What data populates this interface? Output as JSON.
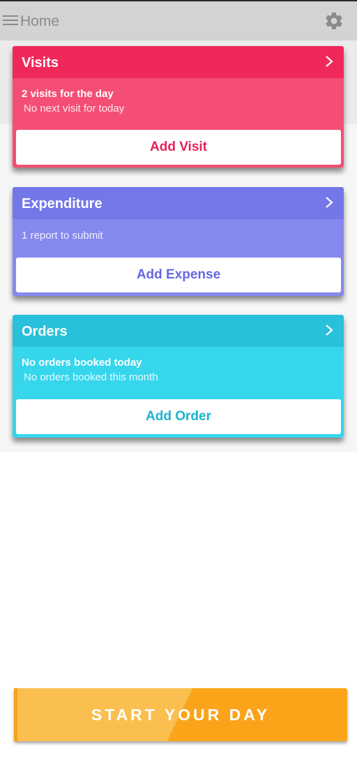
{
  "header": {
    "title": "Home",
    "menu_icon": "menu-icon",
    "settings_icon": "gear-icon"
  },
  "cards": {
    "visits": {
      "title": "Visits",
      "line1": "2 visits for the day",
      "line2": "No next visit for today",
      "button": "Add Visit",
      "header_color": "#f0285a",
      "body_color": "#f54e74",
      "button_text_color": "#e8205a"
    },
    "expenditure": {
      "title": "Expenditure",
      "line1": "1 report to submit",
      "button": "Add Expense",
      "header_color": "#7377e8",
      "body_color": "#8589ef",
      "button_text_color": "#6468e0"
    },
    "orders": {
      "title": "Orders",
      "line1": "No orders booked today",
      "line2": "No orders booked this month",
      "button": "Add Order",
      "header_color": "#28c0da",
      "body_color": "#36d6ec",
      "button_text_color": "#1ab3cf"
    }
  },
  "footer": {
    "start_button": "START YOUR DAY",
    "start_gradient": [
      "#fbbf4f",
      "#fba41a"
    ]
  }
}
